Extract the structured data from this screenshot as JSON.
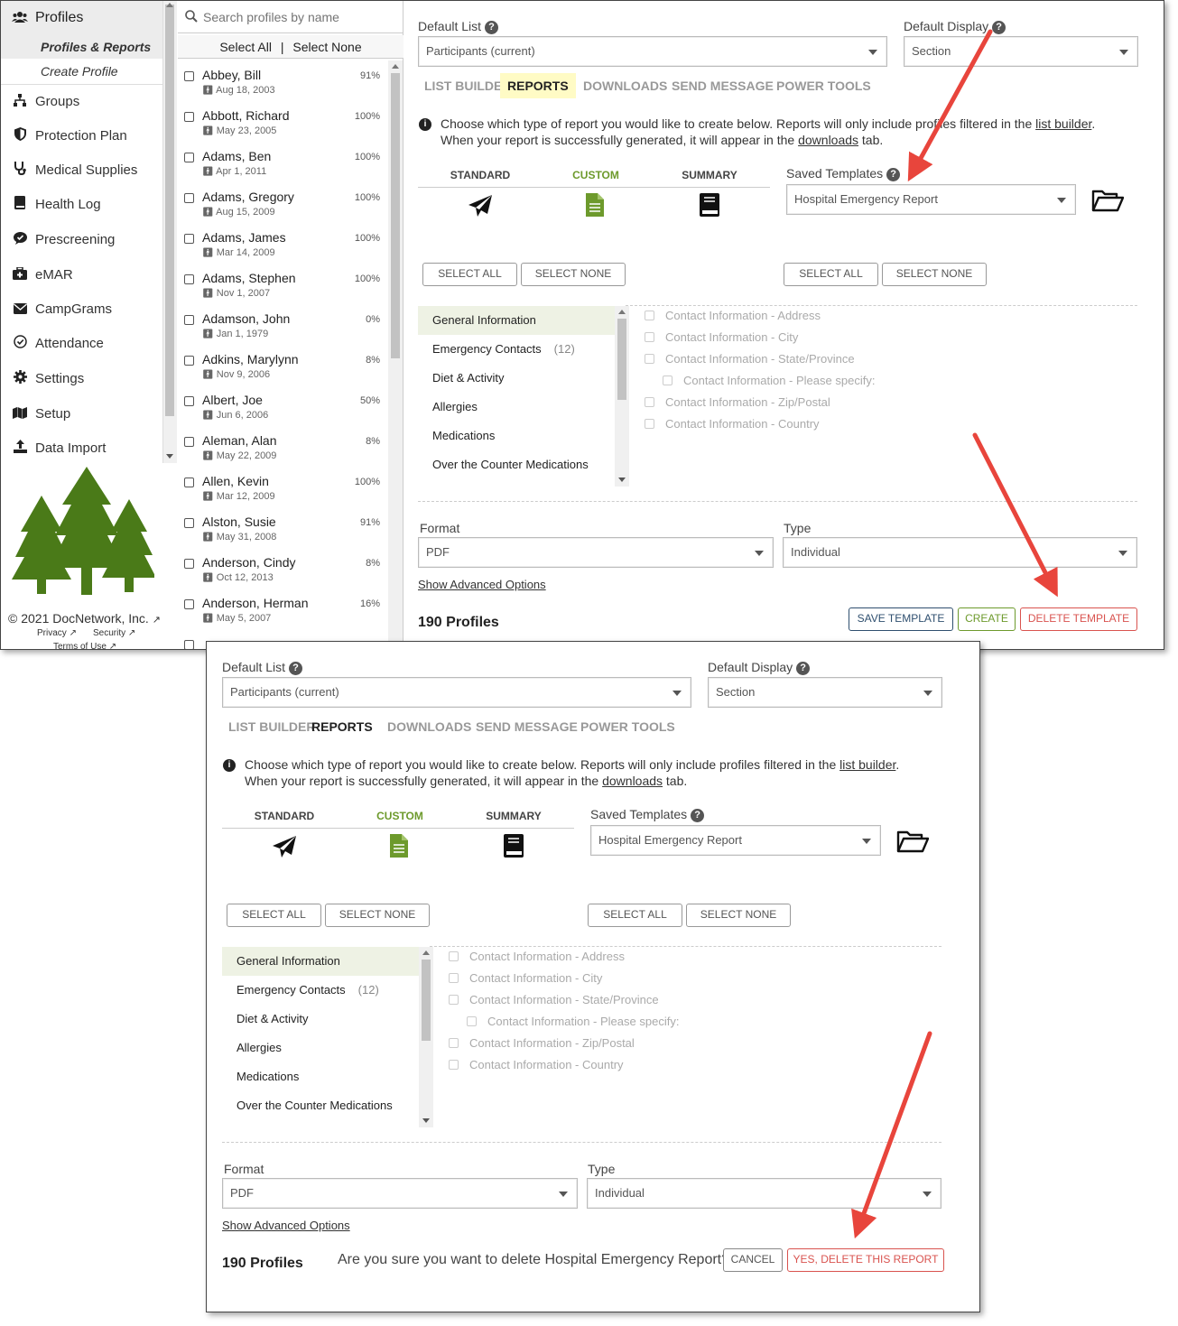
{
  "sidebar": {
    "items": [
      {
        "label": "Profiles",
        "icon": "users-icon"
      },
      {
        "label": "Profiles & Reports"
      },
      {
        "label": "Create Profile"
      },
      {
        "label": "Groups",
        "icon": "sitemap-icon"
      },
      {
        "label": "Protection Plan",
        "icon": "shield-icon"
      },
      {
        "label": "Medical Supplies",
        "icon": "stethoscope-icon"
      },
      {
        "label": "Health Log",
        "icon": "book-icon"
      },
      {
        "label": "Prescreening",
        "icon": "comment-check-icon"
      },
      {
        "label": "eMAR",
        "icon": "medkit-icon"
      },
      {
        "label": "CampGrams",
        "icon": "envelope-icon"
      },
      {
        "label": "Attendance",
        "icon": "check-circle-icon"
      },
      {
        "label": "Settings",
        "icon": "gear-icon"
      },
      {
        "label": "Setup",
        "icon": "map-icon"
      },
      {
        "label": "Data Import",
        "icon": "upload-icon"
      }
    ],
    "footer": {
      "copyright": "© 2021 DocNetwork, Inc.",
      "privacy": "Privacy",
      "security": "Security",
      "terms": "Terms of Use"
    }
  },
  "profile_list": {
    "search_placeholder": "Search profiles by name",
    "select_all": "Select All",
    "separator": "|",
    "select_none": "Select None",
    "rows": [
      {
        "name": "Abbey, Bill",
        "date": "Aug 18, 2003",
        "pct": "91%"
      },
      {
        "name": "Abbott, Richard",
        "date": "May 23, 2005",
        "pct": "100%"
      },
      {
        "name": "Adams, Ben",
        "date": "Apr 1, 2011",
        "pct": "100%"
      },
      {
        "name": "Adams, Gregory",
        "date": "Aug 15, 2009",
        "pct": "100%"
      },
      {
        "name": "Adams, James",
        "date": "Mar 14, 2009",
        "pct": "100%"
      },
      {
        "name": "Adams, Stephen",
        "date": "Nov 1, 2007",
        "pct": "100%"
      },
      {
        "name": "Adamson, John",
        "date": "Jan 1, 1979",
        "pct": "0%"
      },
      {
        "name": "Adkins, Marylynn",
        "date": "Nov 9, 2006",
        "pct": "8%"
      },
      {
        "name": "Albert, Joe",
        "date": "Jun 6, 2006",
        "pct": "50%"
      },
      {
        "name": "Aleman, Alan",
        "date": "May 22, 2009",
        "pct": "8%"
      },
      {
        "name": "Allen, Kevin",
        "date": "Mar 12, 2009",
        "pct": "100%"
      },
      {
        "name": "Alston, Susie",
        "date": "May 31, 2008",
        "pct": "91%"
      },
      {
        "name": "Anderson, Cindy",
        "date": "Oct 12, 2013",
        "pct": "8%"
      },
      {
        "name": "Anderson, Herman",
        "date": "May 5, 2007",
        "pct": "16%"
      }
    ]
  },
  "main": {
    "default_list_label": "Default List",
    "default_list_value": "Participants (current)",
    "default_display_label": "Default Display",
    "default_display_value": "Section",
    "tabs": [
      "LIST BUILDER",
      "REPORTS",
      "DOWNLOADS",
      "SEND MESSAGE",
      "POWER TOOLS"
    ],
    "info_1a": "Choose which type of report you would like to create below. Reports will only include profiles filtered in the ",
    "info_1_link": "list builder",
    "info_1b": ".",
    "info_2a": "When your report is successfully generated, it will appear in the ",
    "info_2_link": "downloads",
    "info_2b": " tab.",
    "report_types": [
      "STANDARD",
      "CUSTOM",
      "SUMMARY"
    ],
    "saved_templates_label": "Saved Templates",
    "saved_template_value": "Hospital Emergency Report",
    "select_all": "SELECT ALL",
    "select_none": "SELECT NONE",
    "categories": [
      {
        "label": "General Information",
        "count": ""
      },
      {
        "label": "Emergency Contacts",
        "count": "(12)"
      },
      {
        "label": "Diet & Activity",
        "count": ""
      },
      {
        "label": "Allergies",
        "count": ""
      },
      {
        "label": "Medications",
        "count": ""
      },
      {
        "label": "Over the Counter Medications",
        "count": ""
      }
    ],
    "fields": [
      "Contact Information - Address",
      "Contact Information - City",
      "Contact Information - State/Province",
      "Contact Information - Please specify:",
      "Contact Information - Zip/Postal",
      "Contact Information - Country"
    ],
    "format_label": "Format",
    "format_value": "PDF",
    "type_label": "Type",
    "type_value": "Individual",
    "advanced_link": "Show Advanced Options",
    "profile_count": "190 Profiles",
    "save_template": "SAVE TEMPLATE",
    "create": "CREATE",
    "delete_template": "DELETE TEMPLATE",
    "confirm_text": "Are you sure you want to delete Hospital Emergency Report?",
    "cancel": "CANCEL",
    "yes_delete": "YES, DELETE THIS REPORT"
  },
  "colors": {
    "accent_green": "#6d9a2c",
    "danger_red": "#d9534f",
    "arrow_red": "#e8453c",
    "tab_highlight": "#fffbc5",
    "tree_green": "#4a7a18"
  }
}
